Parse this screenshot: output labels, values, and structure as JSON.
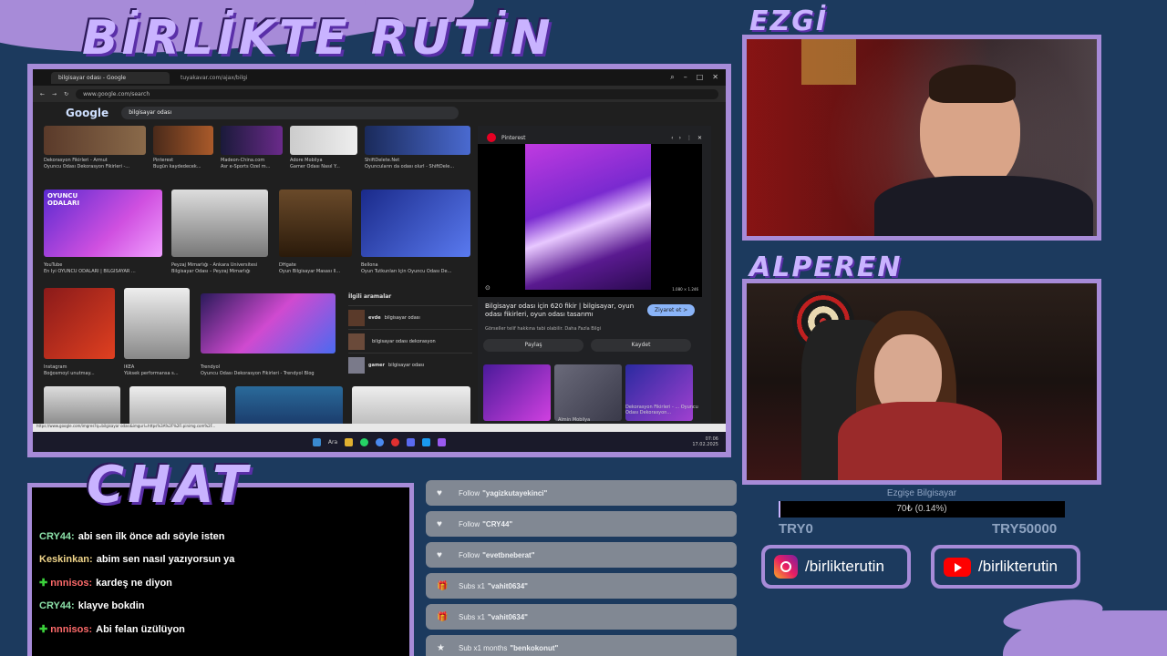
{
  "overlay": {
    "title": "BİRLİKTE RUTİN",
    "chat_title": "CHAT",
    "cam_top_label": "EZGİ",
    "cam_bottom_label": "ALPEREN"
  },
  "browser": {
    "tabs": [
      "bilgisayar odası - Google",
      "tuyakavar.com/ajax/bilgi"
    ],
    "url": "www.google.com/search",
    "search_query": "bilgisayar odası",
    "logo": "Google",
    "results": [
      {
        "source": "Dekorasyon Fikirleri - Armut",
        "title": "Oyuncu Odası Dekorasyon Fikirleri -..."
      },
      {
        "source": "Pinterest",
        "title": "Bugün kaydedecek..."
      },
      {
        "source": "Madeon-China.com",
        "title": "Asr e-Sports Özel m..."
      },
      {
        "source": "Adore Mobilya",
        "title": "Gamer Odası Nasıl Y..."
      },
      {
        "source": "ShiftDelete.Net",
        "title": "Oyuncuların da odası olurl - ShiftDele..."
      },
      {
        "source": "YouTube",
        "title": "En İyi OYUNCU ODALARI | BİLGİSAYAR ..."
      },
      {
        "source": "Peyzaj Mimarlığı - Ankara Üniversitesi",
        "title": "Bilgisayar Odası – Peyzaj Mimarlığı"
      },
      {
        "source": "DHgate",
        "title": "Oyun Bilgisayar Masası İl..."
      },
      {
        "source": "Bellona",
        "title": "Oyun Tutkunları İçin Oyuncu Odası De..."
      },
      {
        "source": "Instagram",
        "title": "Boğosmoyl unutmay..."
      },
      {
        "source": "IKEA",
        "title": "Yüksek performansa s..."
      },
      {
        "source": "Trendyol",
        "title": "Oyuncu Odası Dekorasyon Fikirleri - Trendyol Blog"
      }
    ],
    "thumb_badge": "OYUNCU ODALARI",
    "related": {
      "heading": "İlgili aramalar",
      "items": [
        {
          "bold": "evde",
          "rest": " bilgisayar odası"
        },
        {
          "bold": "",
          "rest": "bilgisayar odası dekorasyon"
        },
        {
          "bold": "gamer",
          "rest": " bilgisayar odası"
        }
      ]
    },
    "side_panel": {
      "source": "Pinterest",
      "image_size": "1.080 × 1.246",
      "title": "Bilgisayar odası için 620 fikir | bilgisayar, oyun odası fikirleri, oyun odası tasarımı",
      "subtitle": "Görseller telif hakkına tabi olabilir. Daha Fazla Bilgi",
      "visit_label": "Ziyaret et >",
      "share_label": "Paylaş",
      "save_label": "Kaydet",
      "thumb_captions": [
        "Almin Mobilya",
        "Dekorasyon Fikirleri - ... Oyuncu Odası Dekorasyon..."
      ]
    },
    "status_url": "https://www.google.com/imgres?q=bilgisayar odası&imgurl=https%3A%2F%2Fi.pinimg.com%2F...",
    "taskbar": {
      "search": "Ara",
      "time": "07:06",
      "date": "17.02.2025"
    }
  },
  "chat": [
    {
      "user": "CRY44:",
      "message": "abi sen ilk önce adı söyle isten",
      "color": "#8be0a8",
      "badge": false
    },
    {
      "user": "Keskinkan:",
      "message": "abim sen nasıl yazıyorsun ya",
      "color": "#f0d58a",
      "badge": false
    },
    {
      "user": "nnnisos:",
      "message": "kardeş ne diyon",
      "color": "#ff6b6b",
      "badge": true
    },
    {
      "user": "CRY44:",
      "message": "klayve bokdin",
      "color": "#8be0a8",
      "badge": false
    },
    {
      "user": "nnnisos:",
      "message": "Abi felan üzülüyon",
      "color": "#ff6b6b",
      "badge": true
    }
  ],
  "events": [
    {
      "icon": "heart-icon",
      "glyph": "♥",
      "type": "Follow",
      "name": "\"yagizkutayekinci\""
    },
    {
      "icon": "heart-icon",
      "glyph": "♥",
      "type": "Follow",
      "name": "\"CRY44\""
    },
    {
      "icon": "heart-icon",
      "glyph": "♥",
      "type": "Follow",
      "name": "\"evetbneberat\""
    },
    {
      "icon": "gift-icon",
      "glyph": "🎁",
      "type": "Subs x1",
      "name": "\"vahit0634\""
    },
    {
      "icon": "gift-icon",
      "glyph": "🎁",
      "type": "Subs x1",
      "name": "\"vahit0634\""
    },
    {
      "icon": "star-icon",
      "glyph": "★",
      "type": "Sub x1 months",
      "name": "\"benkokonut\""
    }
  ],
  "goal": {
    "title": "Ezgişe Bilgisayar",
    "progress_text": "70₺ (0.14%)",
    "progress_fraction": 0.0014,
    "min_label": "TRY0",
    "max_label": "TRY50000"
  },
  "socials": {
    "instagram": "/birlikterutin",
    "youtube": "/birlikterutin"
  },
  "colors": {
    "accent": "#a78bd8",
    "background": "#1c3a5e"
  }
}
